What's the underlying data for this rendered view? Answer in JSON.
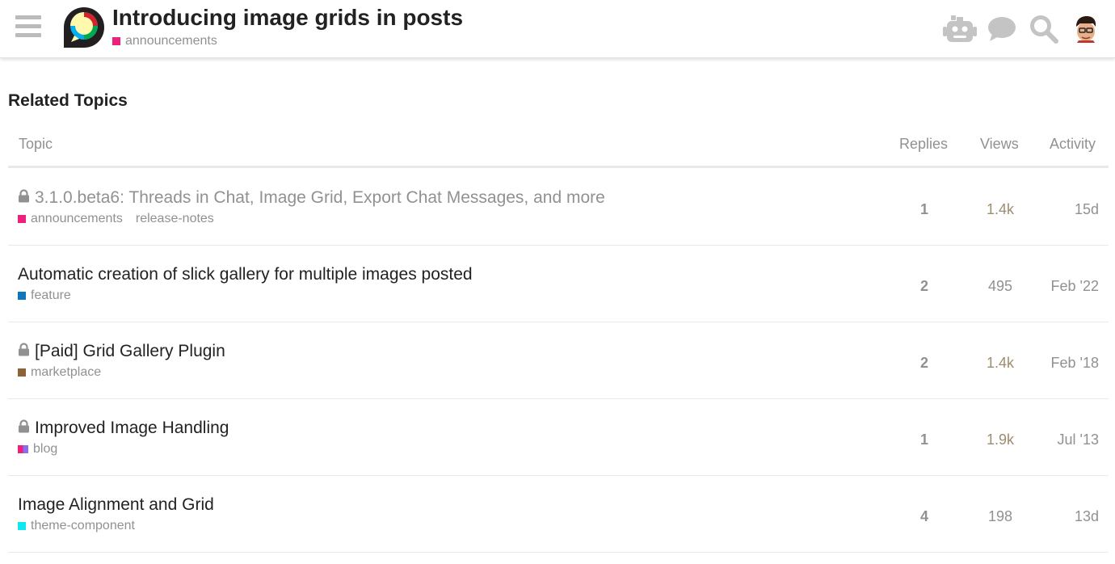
{
  "header": {
    "title": "Introducing image grids in posts",
    "category": "announcements",
    "category_color": "#ED207B",
    "icons": [
      "hamburger-menu-icon",
      "discourse-logo",
      "robot-icon",
      "chat-bubble-icon",
      "search-icon",
      "user-avatar"
    ]
  },
  "related": {
    "heading": "Related Topics",
    "columns": {
      "topic": "Topic",
      "replies": "Replies",
      "views": "Views",
      "activity": "Activity"
    },
    "rows": [
      {
        "title": "3.1.0.beta6: Threads in Chat, Image Grid, Export Chat Messages, and more",
        "locked": true,
        "visited": true,
        "category": "announcements",
        "category_color": "#ED207B",
        "tag": "release-notes",
        "replies": "1",
        "views": "1.4k",
        "activity": "15d"
      },
      {
        "title": "Automatic creation of slick gallery for multiple images posted",
        "locked": false,
        "visited": false,
        "category": "feature",
        "category_color": "#0E76BD",
        "tag": "",
        "replies": "2",
        "views": "495",
        "activity": "Feb '22"
      },
      {
        "title": "[Paid] Grid Gallery Plugin",
        "locked": true,
        "visited": false,
        "category": "marketplace",
        "category_color": "#8C6238",
        "tag": "",
        "replies": "2",
        "views": "1.4k",
        "activity": "Feb '18"
      },
      {
        "title": "Improved Image Handling",
        "locked": true,
        "visited": false,
        "category": "blog",
        "category_color": "#ED207B",
        "category_color_2": "#8C6BEE",
        "tag": "",
        "replies": "1",
        "views": "1.9k",
        "activity": "Jul '13"
      },
      {
        "title": "Image Alignment and Grid",
        "locked": false,
        "visited": false,
        "category": "theme-component",
        "category_color": "#12E6F0",
        "tag": "",
        "replies": "4",
        "views": "198",
        "activity": "13d"
      }
    ],
    "views_colors": {
      "hot": "#9E8C6E",
      "normal": "#919191"
    }
  }
}
